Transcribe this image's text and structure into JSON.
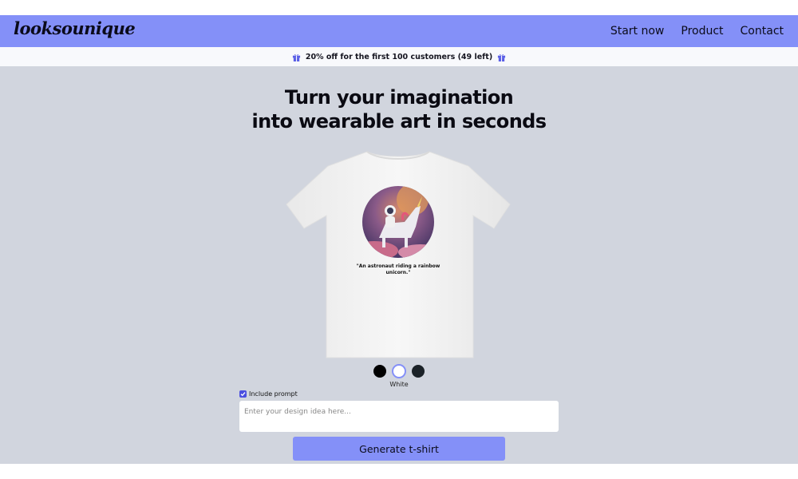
{
  "header": {
    "logo": "looksounique",
    "nav": [
      "Start now",
      "Product",
      "Contact"
    ]
  },
  "promo": {
    "text": "20% off for the first 100 customers (49 left)"
  },
  "hero": {
    "headline_line1": "Turn your imagination",
    "headline_line2": "into wearable art in seconds",
    "shirt_caption_line1": "\"An astronaut riding a rainbow",
    "shirt_caption_line2": "unicorn.\""
  },
  "colors": {
    "options": [
      "#000000",
      "#ffffff",
      "#1b2228"
    ],
    "selected": "White",
    "accent": "#8490f8"
  },
  "form": {
    "include_prompt_label": "Include prompt",
    "include_prompt_checked": true,
    "input_placeholder": "Enter your design idea here...",
    "input_value": "",
    "generate_label": "Generate t-shirt"
  }
}
